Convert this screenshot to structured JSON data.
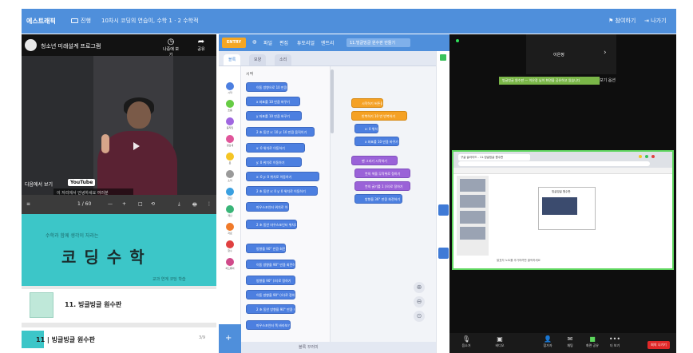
{
  "topbar": {
    "brand": "에스트래픽",
    "links": [
      {
        "label": "진행",
        "icon": "window-icon"
      },
      {
        "label": "10차시 코딩의 연습이, 수학 1 · 2 수학적"
      }
    ],
    "right_links": [
      {
        "label": "참여하기",
        "icon": "people-icon"
      },
      {
        "label": "나가기",
        "icon": "exit-icon"
      }
    ],
    "bg": "#4f8fdb"
  },
  "video": {
    "title": "청소년 미래설계 프로그램",
    "buttons": [
      {
        "label": "나중에 보기",
        "icon": "clock-icon"
      },
      {
        "label": "공유",
        "icon": "share-icon"
      }
    ],
    "subtitle": "이 자리에서 안녕하세요 여러분",
    "watch_on": "다음에서 보기",
    "youtube": "YouTube"
  },
  "pdf": {
    "toolbar": [
      "1 / 60",
      "—",
      "+",
      "□",
      "⟲",
      "⤓",
      "🖶",
      "⋮"
    ],
    "banner_sub": "수학과 함께 생각이 자라는",
    "banner_title": "코딩수학",
    "banner_tag": "교과 연계 코딩 학습",
    "items": [
      {
        "title": "11. 빙글빙글 원수판"
      },
      {
        "title": "11 | 빙글빙글 원수판",
        "page": "3/9"
      }
    ]
  },
  "editor": {
    "menu": [
      "엔트리",
      "파일",
      "편집",
      "튜토리얼"
    ],
    "logo": "ENTRY",
    "project_name": "11.빙글빙글 원수판 만들기",
    "tabs": [
      "블록",
      "모양",
      "소리"
    ],
    "palette_title": "시작",
    "categories": [
      {
        "label": "시작",
        "color": "#4c7fe0"
      },
      {
        "label": "흐름",
        "color": "#66cc44"
      },
      {
        "label": "움직임",
        "color": "#a066e0"
      },
      {
        "label": "생김새",
        "color": "#e0559a"
      },
      {
        "label": "붓",
        "color": "#f5c524"
      },
      {
        "label": "소리",
        "color": "#9a9a9a"
      },
      {
        "label": "판단",
        "color": "#3aa0e0"
      },
      {
        "label": "계산",
        "color": "#39b578"
      },
      {
        "label": "자료",
        "color": "#f07a2a"
      },
      {
        "label": "함수",
        "color": "#e04040"
      },
      {
        "label": "하드웨어",
        "color": "#d04a8a"
      }
    ],
    "palette_blocks": [
      "이동 방향으로 10 만큼 움직이기",
      "x 좌표를 10 만큼 바꾸기",
      "y 좌표를 10 만큼 바꾸기",
      "2 초 동안 x: 10 y: 10 만큼 움직이기",
      "x: 0 위치로 이동하기",
      "y: 0 위치로 이동하기",
      "x: 0 y: 0 위치로 이동하기",
      "2 초 동안 x: 0 y: 0 위치로 이동하기",
      "마우스포인터 위치로 이동하기",
      "2 초 동안 마우스포인터 위치로 이동하기",
      "방향을 90° 만큼 회전하기",
      "이동 방향을 90° 만큼 회전하기",
      "방향을 90° (으)로 정하기",
      "이동 방향을 90° (으)로 정하기",
      "2 초 동안 방향을 90° 만큼 회전하기",
      "마우스포인터 쪽 바라보기"
    ],
    "script_blocks": [
      {
        "text": "시작하기 버튼을 클릭했을 때",
        "color": "orange"
      },
      {
        "text": "반복하기 10 번 반복하기",
        "color": "orange"
      },
      {
        "text": "x: 0 위치로 이동하기",
        "color": "blue"
      },
      {
        "text": "x 좌표를 10 만큼 바꾸기",
        "color": "blue"
      },
      {
        "text": "펜 그리기 시작하기",
        "color": "purple"
      },
      {
        "text": "붓의 색을 무작위로 정하기",
        "color": "purple"
      },
      {
        "text": "붓의 굵기를 1 (으)로 정하기",
        "color": "purple"
      },
      {
        "text": "방향을 36° 만큼 회전하기",
        "color": "blue"
      }
    ],
    "bottom_label": "블록 꾸러미",
    "zoom": [
      "⊕",
      "⊖",
      "⊙"
    ]
  },
  "call": {
    "participant": "이은정",
    "namebar": "빙글빙글 원수판 — 이은정 님이 화면을 공유하고 있습니다",
    "namebar_tail": "보기 옵션",
    "shared_tab": "구글 슬라이드 - 11.빙글빙글 원수판",
    "slide_caption": "빙글빙글 원수판",
    "speaker_note": "발표자 노트를 추가하려면 클릭하세요",
    "toolbar": [
      {
        "label": "음소거",
        "icon": "mic-icon"
      },
      {
        "label": "비디오",
        "icon": "camera-icon"
      },
      {
        "label": "참가자",
        "icon": "participants-icon"
      },
      {
        "label": "채팅",
        "icon": "chat-icon"
      },
      {
        "label": "화면 공유",
        "icon": "share-screen-icon"
      },
      {
        "label": "더 보기",
        "icon": "more-icon"
      }
    ],
    "leave": "회의 나가기",
    "accent": "#5fd65f"
  }
}
